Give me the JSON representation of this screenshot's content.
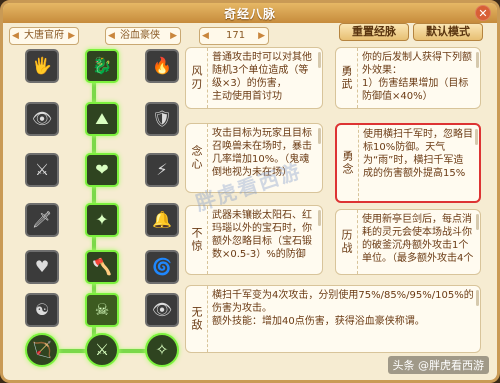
{
  "window": {
    "title": "奇经八脉",
    "close_icon": "✕"
  },
  "filters": {
    "school": "大唐官府",
    "faction": "浴血豪侠",
    "level": "171"
  },
  "buttons": {
    "reset": "重置经脉",
    "default_mode": "默认模式"
  },
  "tree": {
    "nodes": [
      {
        "icon": "🖐"
      },
      {
        "icon": "🐉"
      },
      {
        "icon": "🔥"
      },
      {
        "icon": "👁"
      },
      {
        "icon": "⛰"
      },
      {
        "icon": "🛡"
      },
      {
        "icon": "⚔"
      },
      {
        "icon": "❤"
      },
      {
        "icon": "⚡"
      },
      {
        "icon": "🗡"
      },
      {
        "icon": "✦"
      },
      {
        "icon": "🔔"
      },
      {
        "icon": "♥"
      },
      {
        "icon": "🪓"
      },
      {
        "icon": "🌀"
      },
      {
        "icon": "☯"
      },
      {
        "icon": "☠"
      },
      {
        "icon": "👁"
      },
      {
        "icon": "🏹"
      },
      {
        "icon": "⚔"
      },
      {
        "icon": "✧"
      },
      {
        "icon": "🌪"
      },
      {
        "icon": "🪶"
      },
      {
        "icon": "🐲"
      }
    ]
  },
  "cards": [
    {
      "name": "风刃",
      "text": "普通攻击时可以对其他随机3个单位造成（等级×3）的伤害，\n主动使用首讨功"
    },
    {
      "name": "勇武",
      "text": "你的后发制人获得下列额外效果：\n1）伤害结果增加（目标防御值×40%）"
    },
    {
      "name": "念心",
      "text": "攻击目标为玩家且目标召唤兽未在场时，暴击几率增加10%。（鬼魂倒地视为未在场）"
    },
    {
      "name": "勇念",
      "text": "使用横扫千军时，忽略目标10%防御。天气为“雨”时，横扫千军造成的伤害额外提高15%"
    },
    {
      "name": "不惊",
      "text": "武器未镶嵌太阳石、红玛瑙以外的宝石时，你额外忽略目标（宝石锻数×0.5-3）%的防御"
    },
    {
      "name": "历战",
      "text": "使用新亭巨剑后，每点消耗的灵元会使本场战斗你的破釜沉舟额外攻击1个单位。（最多额外攻击4个"
    },
    {
      "name": "无敌",
      "text": "横扫千军变为4次攻击，分别使用75%/85%/95%/105%的伤害为攻击。\n额外技能：增加40点伤害，获得浴血豪侠称谓。"
    }
  ],
  "overlay": {
    "watermark": "胖虎看西游",
    "corner": "头条 @胖虎看西游"
  }
}
